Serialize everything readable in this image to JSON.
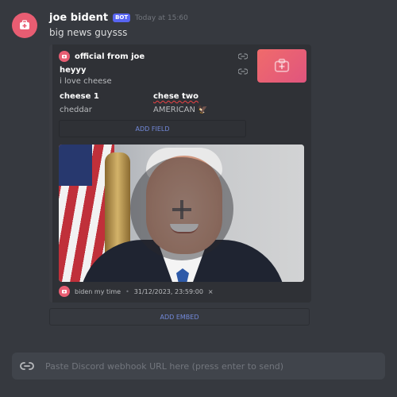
{
  "message": {
    "username": "joe bident",
    "badge": "BOT",
    "timestamp": "Today at 15:60",
    "content": "big news guysss"
  },
  "embed": {
    "author": "official from joe",
    "title": "heyyy",
    "description": "i love cheese",
    "fields": [
      {
        "name": "cheese 1",
        "value": "cheddar"
      },
      {
        "name": "chese two",
        "value": "AMERICAN 🦅"
      }
    ],
    "add_field_label": "ADD FIELD",
    "footer_text": "biden my time",
    "footer_timestamp": "31/12/2023, 23:59:00",
    "footer_close": "×"
  },
  "add_embed_label": "ADD EMBED",
  "input": {
    "placeholder": "Paste Discord webhook URL here (press enter to send)",
    "value": ""
  },
  "colors": {
    "background": "#36393f",
    "embed_bg": "#2f3136",
    "accent_pink": "#e85d72",
    "link_blue": "#7289da",
    "bot_badge": "#5865f2"
  },
  "icons": {
    "avatar": "medical-bag-icon",
    "link": "link-icon",
    "thumbnail": "medical-bag-icon",
    "image_overlay": "plus-icon",
    "input": "link-icon"
  }
}
